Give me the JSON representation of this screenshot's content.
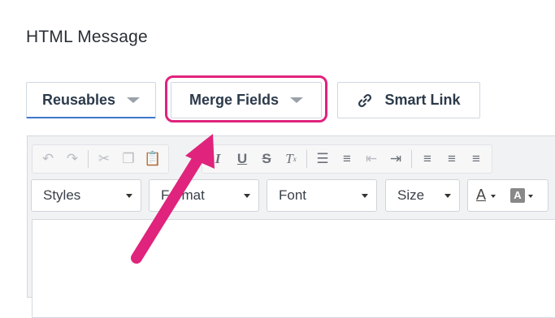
{
  "heading": "HTML Message",
  "buttons": {
    "reusables": "Reusables",
    "merge_fields": "Merge Fields",
    "smart_link": "Smart Link"
  },
  "toolbar_icons": [
    "undo-icon",
    "redo-icon",
    "cut-icon",
    "copy-icon",
    "paste-icon",
    "italic-icon",
    "underline-icon",
    "strikethrough-icon",
    "clear-format-icon",
    "numbered-list-icon",
    "bulleted-list-icon",
    "outdent-icon",
    "indent-icon",
    "align-left-icon",
    "align-center-icon",
    "align-right-icon"
  ],
  "dropdowns": {
    "styles": "Styles",
    "format": "Format",
    "font": "Font",
    "size": "Size"
  },
  "colors": {
    "highlight": "#e0237c",
    "accent": "#3e77c8"
  }
}
